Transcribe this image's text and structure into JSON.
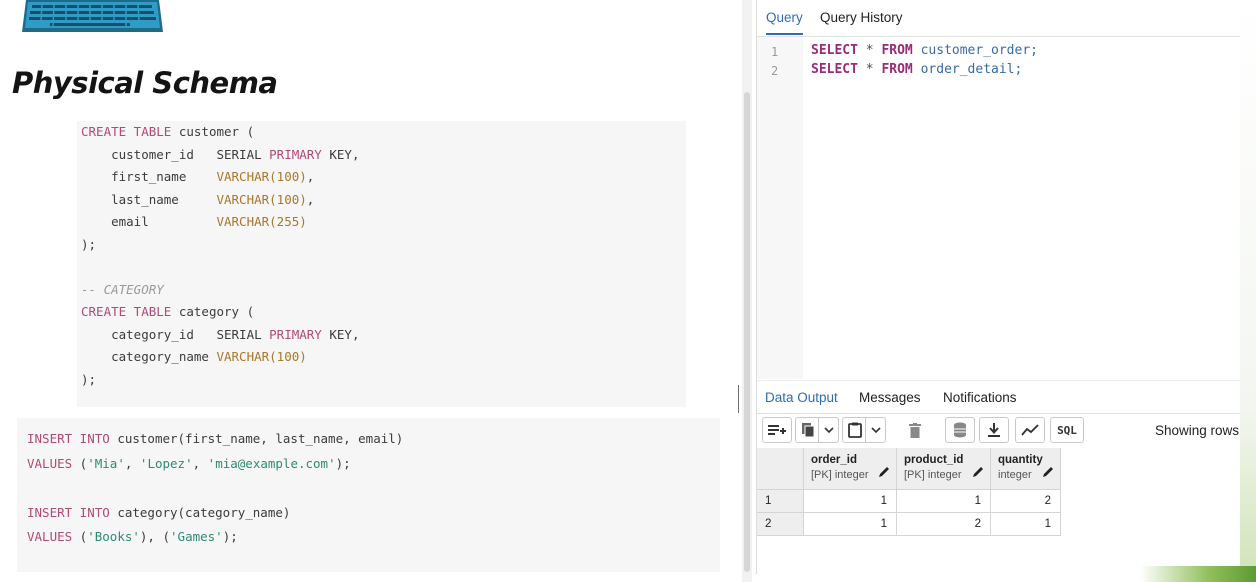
{
  "slide": {
    "title": "Physical Schema",
    "ddl_lines": [
      [
        {
          "t": "CREATE TABLE",
          "c": "kw"
        },
        {
          "t": " customer (",
          "c": ""
        }
      ],
      [
        {
          "t": "    customer_id   SERIAL ",
          "c": ""
        },
        {
          "t": "PRIMARY",
          "c": "kw"
        },
        {
          "t": " KEY,",
          "c": ""
        }
      ],
      [
        {
          "t": "    first_name    ",
          "c": ""
        },
        {
          "t": "VARCHAR(100)",
          "c": "ty"
        },
        {
          "t": ",",
          "c": ""
        }
      ],
      [
        {
          "t": "    last_name     ",
          "c": ""
        },
        {
          "t": "VARCHAR(100)",
          "c": "ty"
        },
        {
          "t": ",",
          "c": ""
        }
      ],
      [
        {
          "t": "    email         ",
          "c": ""
        },
        {
          "t": "VARCHAR(255)",
          "c": "ty"
        }
      ],
      [
        {
          "t": ");",
          "c": ""
        }
      ],
      [
        {
          "t": "",
          "c": ""
        }
      ],
      [
        {
          "t": "-- CATEGORY",
          "c": "cm"
        }
      ],
      [
        {
          "t": "CREATE TABLE",
          "c": "kw"
        },
        {
          "t": " category (",
          "c": ""
        }
      ],
      [
        {
          "t": "    category_id   SERIAL ",
          "c": ""
        },
        {
          "t": "PRIMARY",
          "c": "kw"
        },
        {
          "t": " KEY,",
          "c": ""
        }
      ],
      [
        {
          "t": "    category_name ",
          "c": ""
        },
        {
          "t": "VARCHAR(100)",
          "c": "ty"
        }
      ],
      [
        {
          "t": ");",
          "c": ""
        }
      ]
    ],
    "insert_lines": [
      [
        {
          "t": "INSERT INTO",
          "c": "kw"
        },
        {
          "t": " customer(first_name, last_name, email)",
          "c": ""
        }
      ],
      [
        {
          "t": "VALUES",
          "c": "kw"
        },
        {
          "t": " (",
          "c": ""
        },
        {
          "t": "'Mia'",
          "c": "str"
        },
        {
          "t": ", ",
          "c": ""
        },
        {
          "t": "'Lopez'",
          "c": "str"
        },
        {
          "t": ", ",
          "c": ""
        },
        {
          "t": "'mia@example.com'",
          "c": "str"
        },
        {
          "t": ");",
          "c": ""
        }
      ],
      [
        {
          "t": "",
          "c": ""
        }
      ],
      [
        {
          "t": "INSERT INTO",
          "c": "kw"
        },
        {
          "t": " category(category_name)",
          "c": ""
        }
      ],
      [
        {
          "t": "VALUES",
          "c": "kw"
        },
        {
          "t": " (",
          "c": ""
        },
        {
          "t": "'Books'",
          "c": "str"
        },
        {
          "t": "), (",
          "c": ""
        },
        {
          "t": "'Games'",
          "c": "str"
        },
        {
          "t": ");",
          "c": ""
        }
      ]
    ]
  },
  "editor": {
    "tabs": [
      "Query",
      "Query History"
    ],
    "line_numbers": [
      "1",
      "2"
    ],
    "query_lines": [
      [
        {
          "t": "SELECT",
          "c": "qkw"
        },
        {
          "t": " * ",
          "c": ""
        },
        {
          "t": "FROM",
          "c": "qkw"
        },
        {
          "t": " customer_order;",
          "c": "qid"
        }
      ],
      [
        {
          "t": "SELECT",
          "c": "qkw"
        },
        {
          "t": " * ",
          "c": ""
        },
        {
          "t": "FROM",
          "c": "qkw"
        },
        {
          "t": " order_detail;",
          "c": "qid"
        }
      ]
    ]
  },
  "output": {
    "tabs": [
      "Data Output",
      "Messages",
      "Notifications"
    ],
    "toolbar": {
      "icons": [
        "add-row-icon",
        "copy-icon",
        "chevron-down-icon",
        "paste-icon",
        "chevron-down-icon",
        "delete-icon",
        "save-data-icon",
        "download-icon",
        "graph-icon"
      ],
      "sql_label": "SQL",
      "showing_rows": "Showing rows:"
    },
    "columns": [
      {
        "name": "order_id",
        "type": "[PK] integer"
      },
      {
        "name": "product_id",
        "type": "[PK] integer"
      },
      {
        "name": "quantity",
        "type": "integer"
      }
    ],
    "rows": [
      {
        "num": "1",
        "values": [
          "1",
          "1",
          "2"
        ]
      },
      {
        "num": "2",
        "values": [
          "1",
          "2",
          "1"
        ]
      }
    ]
  },
  "colors": {
    "accent": "#2f6db3",
    "keyword": "#b04a76",
    "type": "#a9772b",
    "string": "#2f8a73",
    "query_keyword": "#9b2a78"
  }
}
